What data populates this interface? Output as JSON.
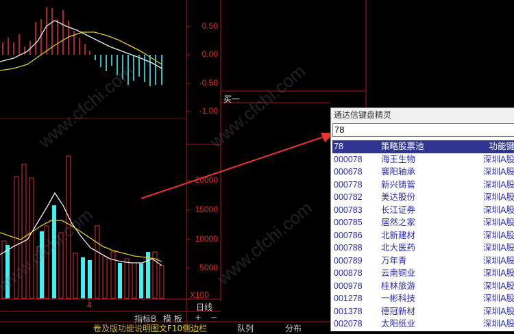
{
  "macd_axis": {
    "ticks": [
      "0.50",
      "0.00",
      "-0.50",
      "-1.00"
    ]
  },
  "volume_axis": {
    "ticks": [
      "20000",
      "15000",
      "10000",
      "5000"
    ],
    "unit": "X100"
  },
  "side_label": "买一",
  "x_marker": "4",
  "footer": {
    "period": "日线",
    "indicator_button": "指标B",
    "template_button": "模 板",
    "plus": "+",
    "minus": "−",
    "ticker_text": "卷及版功能说明",
    "ticker_highlight": "图文F10侧边栏",
    "queue_tab": "队列",
    "distribution_tab": "分布"
  },
  "watermark": "www.cfchi.com",
  "keyboard_wizard": {
    "title": "通达信键盘精灵",
    "input_value": "78",
    "rows": [
      {
        "code": "78",
        "name": "策略股票池",
        "market": "功能键",
        "selected": true
      },
      {
        "code": "000078",
        "name": "海王生物",
        "market": "深圳A股"
      },
      {
        "code": "000678",
        "name": "襄阳轴承",
        "market": "深圳A股"
      },
      {
        "code": "000778",
        "name": "新兴铸管",
        "market": "深圳A股"
      },
      {
        "code": "000782",
        "name": "美达股份",
        "market": "深圳A股"
      },
      {
        "code": "000783",
        "name": "长江证券",
        "market": "深圳A股"
      },
      {
        "code": "000785",
        "name": "居然之家",
        "market": "深圳A股"
      },
      {
        "code": "000786",
        "name": "北新建材",
        "market": "深圳A股"
      },
      {
        "code": "000788",
        "name": "北大医药",
        "market": "深圳A股"
      },
      {
        "code": "000789",
        "name": "万年青",
        "market": "深圳A股"
      },
      {
        "code": "000878",
        "name": "云南铜业",
        "market": "深圳A股"
      },
      {
        "code": "000978",
        "name": "桂林旅游",
        "market": "深圳A股"
      },
      {
        "code": "001278",
        "name": "一彬科技",
        "market": "深圳A股"
      },
      {
        "code": "001378",
        "name": "德冠新材",
        "market": "深圳A股"
      },
      {
        "code": "002078",
        "name": "太阳纸业",
        "market": "深圳A股"
      }
    ]
  },
  "colors": {
    "axis_red": "#e0302f",
    "bar_cyan": "#3ff0f0",
    "ma_yellow": "#e8d020",
    "ma_white": "#f0f0f0",
    "select_blue": "#2f3590",
    "arrow_red": "#e8332e"
  }
}
